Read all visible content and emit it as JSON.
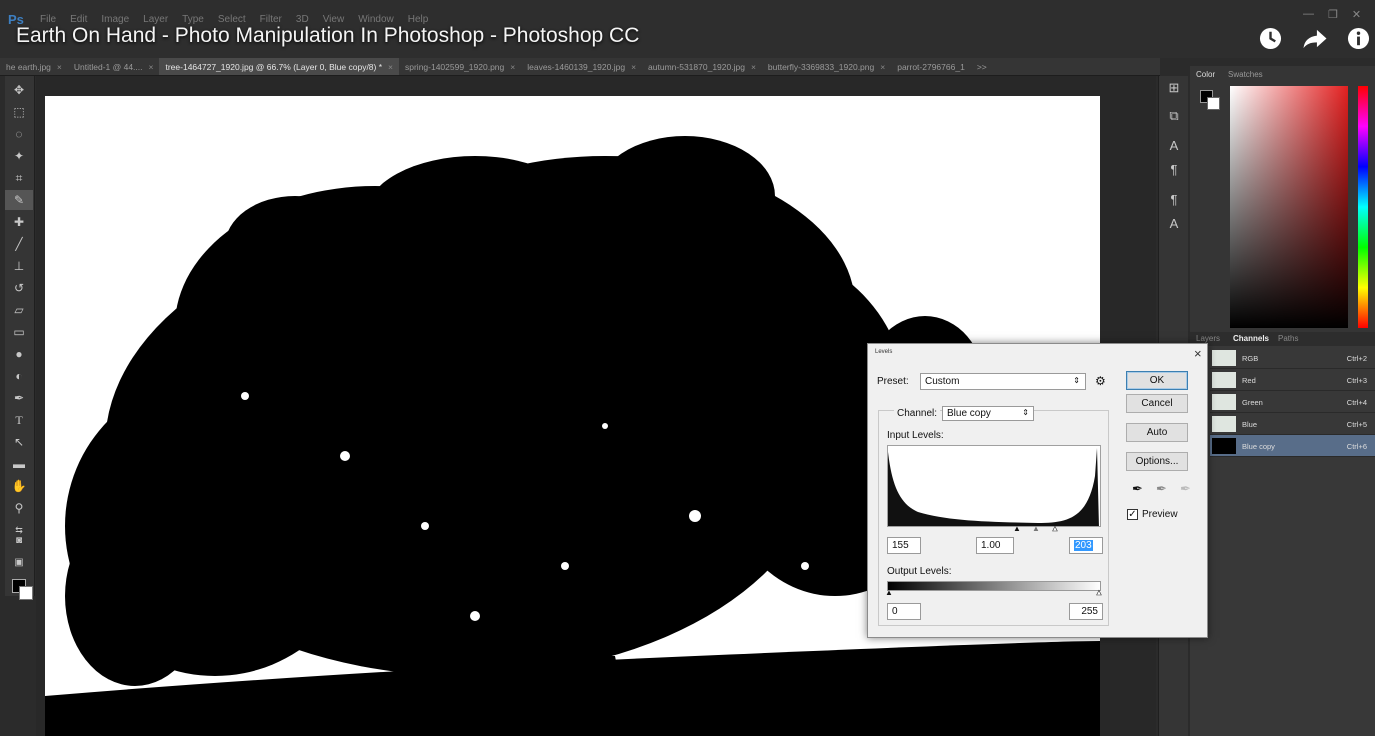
{
  "app": {
    "logo": "Ps",
    "menu": [
      "File",
      "Edit",
      "Image",
      "Layer",
      "Type",
      "Select",
      "Filter",
      "3D",
      "View",
      "Window",
      "Help"
    ],
    "video_title": "Earth On Hand - Photo Manipulation In Photoshop - Photoshop CC"
  },
  "tabs": [
    {
      "label": "he earth.jpg",
      "active": false
    },
    {
      "label": "Untitled-1 @ 44....",
      "active": false
    },
    {
      "label": "tree-1464727_1920.jpg @ 66.7% (Layer 0, Blue copy/8) *",
      "active": true
    },
    {
      "label": "spring-1402599_1920.png",
      "active": false
    },
    {
      "label": "leaves-1460139_1920.jpg",
      "active": false
    },
    {
      "label": "autumn-531870_1920.jpg",
      "active": false
    },
    {
      "label": "butterfly-3369833_1920.png",
      "active": false
    },
    {
      "label": "parrot-2796766_1",
      "active": false
    }
  ],
  "tab_close": "×",
  "tab_overflow": ">>",
  "color_panel": {
    "tabs": [
      "Color",
      "Swatches"
    ]
  },
  "layers_panel": {
    "tabs": [
      "Layers",
      "Channels",
      "Paths"
    ],
    "channels": [
      {
        "name": "RGB",
        "shortcut": "Ctrl+2",
        "selected": false
      },
      {
        "name": "Red",
        "shortcut": "Ctrl+3",
        "selected": false
      },
      {
        "name": "Green",
        "shortcut": "Ctrl+4",
        "selected": false
      },
      {
        "name": "Blue",
        "shortcut": "Ctrl+5",
        "selected": false
      },
      {
        "name": "Blue copy",
        "shortcut": "Ctrl+6",
        "selected": true
      }
    ]
  },
  "levels": {
    "title": "Levels",
    "preset_label": "Preset:",
    "preset_value": "Custom",
    "channel_label": "Channel:",
    "channel_value": "Blue copy",
    "input_levels_label": "Input Levels:",
    "input_black": "155",
    "input_gamma": "1.00",
    "input_white": "203",
    "output_levels_label": "Output Levels:",
    "output_black": "0",
    "output_white": "255",
    "ok": "OK",
    "cancel": "Cancel",
    "auto": "Auto",
    "options": "Options...",
    "preview_label": "Preview",
    "preview_checked": true,
    "close": "×",
    "dropdown_arrow": "⇕"
  },
  "colors": {
    "accent": "#3d7fc1",
    "selection": "#586d89",
    "dialog_bg": "#f0f0f0"
  }
}
